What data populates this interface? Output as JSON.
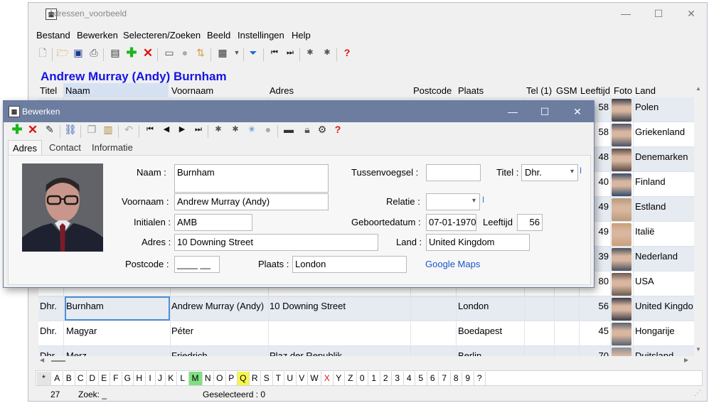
{
  "window": {
    "title": "Adressen_voorbeeld"
  },
  "menu": [
    "Bestand",
    "Bewerken",
    "Selecteren/Zoeken",
    "Beeld",
    "Instellingen",
    "Help"
  ],
  "record_title": "Andrew Murray (Andy) Burnham",
  "grid": {
    "headers": [
      "Titel",
      "Naam",
      "Voornaam",
      "Adres",
      "Postcode",
      "Plaats",
      "Tel (1)",
      "GSM",
      "Leeftijd",
      "Foto",
      "Land"
    ],
    "rows": [
      {
        "titel": "",
        "naam": "",
        "voornaam": "",
        "adres": "",
        "plaats": "",
        "leeftijd": "58",
        "land": "Polen",
        "photo_color": "#3a3f4a"
      },
      {
        "titel": "",
        "naam": "",
        "voornaam": "",
        "adres": "",
        "plaats": "",
        "leeftijd": "58",
        "land": "Griekenland",
        "photo_color": "#4a5266"
      },
      {
        "titel": "",
        "naam": "",
        "voornaam": "",
        "adres": "",
        "plaats": "",
        "leeftijd": "48",
        "land": "Denemarken",
        "photo_color": "#5a4a44"
      },
      {
        "titel": "",
        "naam": "",
        "voornaam": "",
        "adres": "",
        "plaats": "",
        "leeftijd": "40",
        "land": "Finland",
        "photo_color": "#354a6a"
      },
      {
        "titel": "",
        "naam": "",
        "voornaam": "",
        "adres": "",
        "plaats": "",
        "leeftijd": "49",
        "land": "Estland",
        "photo_color": "#b89a7a"
      },
      {
        "titel": "",
        "naam": "",
        "voornaam": "",
        "adres": "",
        "plaats": "",
        "leeftijd": "49",
        "land": "Italië",
        "photo_color": "#c9a07a"
      },
      {
        "titel": "",
        "naam": "",
        "voornaam": "",
        "adres": "",
        "plaats": "",
        "leeftijd": "39",
        "land": "Nederland",
        "photo_color": "#4a4f5a"
      },
      {
        "titel": "",
        "naam": "",
        "voornaam": "",
        "adres": "",
        "plaats": "",
        "leeftijd": "80",
        "land": "USA",
        "photo_color": "#6a5a50"
      },
      {
        "titel": "Dhr.",
        "naam": "Burnham",
        "voornaam": "Andrew Murray (Andy)",
        "adres": "10 Downing Street",
        "plaats": "London",
        "leeftijd": "56",
        "land": "United Kingdo",
        "photo_color": "#3b3b44"
      },
      {
        "titel": "Dhr.",
        "naam": "Magyar",
        "voornaam": "Péter",
        "adres": "",
        "plaats": "Boedapest",
        "leeftijd": "45",
        "land": "Hongarije",
        "photo_color": "#5a6270"
      },
      {
        "titel": "Dhr.",
        "naam": "Merz",
        "voornaam": "Friedrich",
        "adres": "Plaz der Republik",
        "plaats": "Berlin",
        "leeftijd": "70",
        "land": "Duitsland",
        "photo_color": "#8a8e94"
      }
    ]
  },
  "alphabet": [
    "*",
    "A",
    "B",
    "C",
    "D",
    "E",
    "F",
    "G",
    "H",
    "I",
    "J",
    "K",
    "L",
    "M",
    "N",
    "O",
    "P",
    "Q",
    "R",
    "S",
    "T",
    "U",
    "V",
    "W",
    "X",
    "Y",
    "Z",
    "0",
    "1",
    "2",
    "3",
    "4",
    "5",
    "6",
    "7",
    "8",
    "9",
    "?"
  ],
  "alphabet_highlight": {
    "M": "#7fe07f",
    "Q": "#f7f74a"
  },
  "alphabet_red": [
    "X"
  ],
  "status": {
    "count": "27",
    "zoek": "Zoek: _",
    "geselecteerd": "Geselecteerd : 0"
  },
  "dialog": {
    "title": "Bewerken",
    "tabs": [
      "Adres",
      "Contact",
      "Informatie"
    ],
    "labels": {
      "naam": "Naam :",
      "tussenvoegsel": "Tussenvoegsel :",
      "titel": "Titel :",
      "voornaam": "Voornaam :",
      "relatie": "Relatie :",
      "initialen": "Initialen :",
      "geboortedatum": "Geboortedatum :",
      "leeftijd": "Leeftijd",
      "adres": "Adres :",
      "land": "Land :",
      "postcode": "Postcode :",
      "plaats": "Plaats :"
    },
    "values": {
      "naam": "Burnham",
      "tussenvoegsel": "",
      "titel": "Dhr.",
      "voornaam": "Andrew Murray (Andy)",
      "relatie": "",
      "initialen": "AMB",
      "geboortedatum": "07-01-1970",
      "leeftijd": "56",
      "adres": "10 Downing Street",
      "land": "United Kingdom",
      "postcode": "____ __",
      "plaats": "London"
    },
    "google_maps": "Google Maps"
  }
}
